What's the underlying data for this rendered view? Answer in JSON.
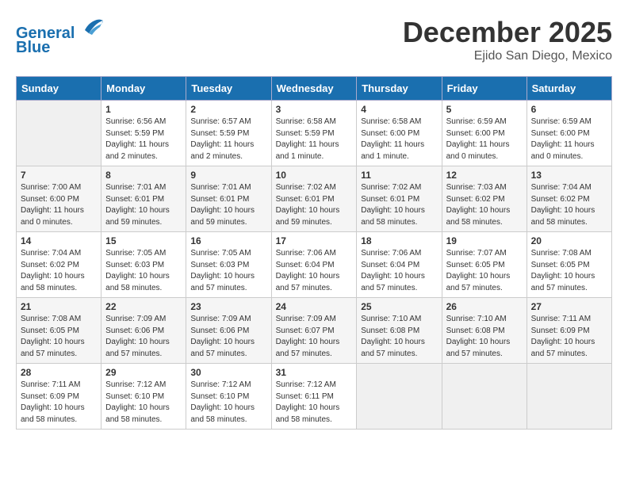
{
  "header": {
    "logo_line1": "General",
    "logo_line2": "Blue",
    "month": "December 2025",
    "location": "Ejido San Diego, Mexico"
  },
  "days_of_week": [
    "Sunday",
    "Monday",
    "Tuesday",
    "Wednesday",
    "Thursday",
    "Friday",
    "Saturday"
  ],
  "weeks": [
    [
      {
        "day": "",
        "empty": true
      },
      {
        "day": "1",
        "sunrise": "Sunrise: 6:56 AM",
        "sunset": "Sunset: 5:59 PM",
        "daylight": "Daylight: 11 hours and 2 minutes."
      },
      {
        "day": "2",
        "sunrise": "Sunrise: 6:57 AM",
        "sunset": "Sunset: 5:59 PM",
        "daylight": "Daylight: 11 hours and 2 minutes."
      },
      {
        "day": "3",
        "sunrise": "Sunrise: 6:58 AM",
        "sunset": "Sunset: 5:59 PM",
        "daylight": "Daylight: 11 hours and 1 minute."
      },
      {
        "day": "4",
        "sunrise": "Sunrise: 6:58 AM",
        "sunset": "Sunset: 6:00 PM",
        "daylight": "Daylight: 11 hours and 1 minute."
      },
      {
        "day": "5",
        "sunrise": "Sunrise: 6:59 AM",
        "sunset": "Sunset: 6:00 PM",
        "daylight": "Daylight: 11 hours and 0 minutes."
      },
      {
        "day": "6",
        "sunrise": "Sunrise: 6:59 AM",
        "sunset": "Sunset: 6:00 PM",
        "daylight": "Daylight: 11 hours and 0 minutes."
      }
    ],
    [
      {
        "day": "7",
        "sunrise": "Sunrise: 7:00 AM",
        "sunset": "Sunset: 6:00 PM",
        "daylight": "Daylight: 11 hours and 0 minutes."
      },
      {
        "day": "8",
        "sunrise": "Sunrise: 7:01 AM",
        "sunset": "Sunset: 6:01 PM",
        "daylight": "Daylight: 10 hours and 59 minutes."
      },
      {
        "day": "9",
        "sunrise": "Sunrise: 7:01 AM",
        "sunset": "Sunset: 6:01 PM",
        "daylight": "Daylight: 10 hours and 59 minutes."
      },
      {
        "day": "10",
        "sunrise": "Sunrise: 7:02 AM",
        "sunset": "Sunset: 6:01 PM",
        "daylight": "Daylight: 10 hours and 59 minutes."
      },
      {
        "day": "11",
        "sunrise": "Sunrise: 7:02 AM",
        "sunset": "Sunset: 6:01 PM",
        "daylight": "Daylight: 10 hours and 58 minutes."
      },
      {
        "day": "12",
        "sunrise": "Sunrise: 7:03 AM",
        "sunset": "Sunset: 6:02 PM",
        "daylight": "Daylight: 10 hours and 58 minutes."
      },
      {
        "day": "13",
        "sunrise": "Sunrise: 7:04 AM",
        "sunset": "Sunset: 6:02 PM",
        "daylight": "Daylight: 10 hours and 58 minutes."
      }
    ],
    [
      {
        "day": "14",
        "sunrise": "Sunrise: 7:04 AM",
        "sunset": "Sunset: 6:02 PM",
        "daylight": "Daylight: 10 hours and 58 minutes."
      },
      {
        "day": "15",
        "sunrise": "Sunrise: 7:05 AM",
        "sunset": "Sunset: 6:03 PM",
        "daylight": "Daylight: 10 hours and 58 minutes."
      },
      {
        "day": "16",
        "sunrise": "Sunrise: 7:05 AM",
        "sunset": "Sunset: 6:03 PM",
        "daylight": "Daylight: 10 hours and 57 minutes."
      },
      {
        "day": "17",
        "sunrise": "Sunrise: 7:06 AM",
        "sunset": "Sunset: 6:04 PM",
        "daylight": "Daylight: 10 hours and 57 minutes."
      },
      {
        "day": "18",
        "sunrise": "Sunrise: 7:06 AM",
        "sunset": "Sunset: 6:04 PM",
        "daylight": "Daylight: 10 hours and 57 minutes."
      },
      {
        "day": "19",
        "sunrise": "Sunrise: 7:07 AM",
        "sunset": "Sunset: 6:05 PM",
        "daylight": "Daylight: 10 hours and 57 minutes."
      },
      {
        "day": "20",
        "sunrise": "Sunrise: 7:08 AM",
        "sunset": "Sunset: 6:05 PM",
        "daylight": "Daylight: 10 hours and 57 minutes."
      }
    ],
    [
      {
        "day": "21",
        "sunrise": "Sunrise: 7:08 AM",
        "sunset": "Sunset: 6:05 PM",
        "daylight": "Daylight: 10 hours and 57 minutes."
      },
      {
        "day": "22",
        "sunrise": "Sunrise: 7:09 AM",
        "sunset": "Sunset: 6:06 PM",
        "daylight": "Daylight: 10 hours and 57 minutes."
      },
      {
        "day": "23",
        "sunrise": "Sunrise: 7:09 AM",
        "sunset": "Sunset: 6:06 PM",
        "daylight": "Daylight: 10 hours and 57 minutes."
      },
      {
        "day": "24",
        "sunrise": "Sunrise: 7:09 AM",
        "sunset": "Sunset: 6:07 PM",
        "daylight": "Daylight: 10 hours and 57 minutes."
      },
      {
        "day": "25",
        "sunrise": "Sunrise: 7:10 AM",
        "sunset": "Sunset: 6:08 PM",
        "daylight": "Daylight: 10 hours and 57 minutes."
      },
      {
        "day": "26",
        "sunrise": "Sunrise: 7:10 AM",
        "sunset": "Sunset: 6:08 PM",
        "daylight": "Daylight: 10 hours and 57 minutes."
      },
      {
        "day": "27",
        "sunrise": "Sunrise: 7:11 AM",
        "sunset": "Sunset: 6:09 PM",
        "daylight": "Daylight: 10 hours and 57 minutes."
      }
    ],
    [
      {
        "day": "28",
        "sunrise": "Sunrise: 7:11 AM",
        "sunset": "Sunset: 6:09 PM",
        "daylight": "Daylight: 10 hours and 58 minutes."
      },
      {
        "day": "29",
        "sunrise": "Sunrise: 7:12 AM",
        "sunset": "Sunset: 6:10 PM",
        "daylight": "Daylight: 10 hours and 58 minutes."
      },
      {
        "day": "30",
        "sunrise": "Sunrise: 7:12 AM",
        "sunset": "Sunset: 6:10 PM",
        "daylight": "Daylight: 10 hours and 58 minutes."
      },
      {
        "day": "31",
        "sunrise": "Sunrise: 7:12 AM",
        "sunset": "Sunset: 6:11 PM",
        "daylight": "Daylight: 10 hours and 58 minutes."
      },
      {
        "day": "",
        "empty": true
      },
      {
        "day": "",
        "empty": true
      },
      {
        "day": "",
        "empty": true
      }
    ]
  ]
}
